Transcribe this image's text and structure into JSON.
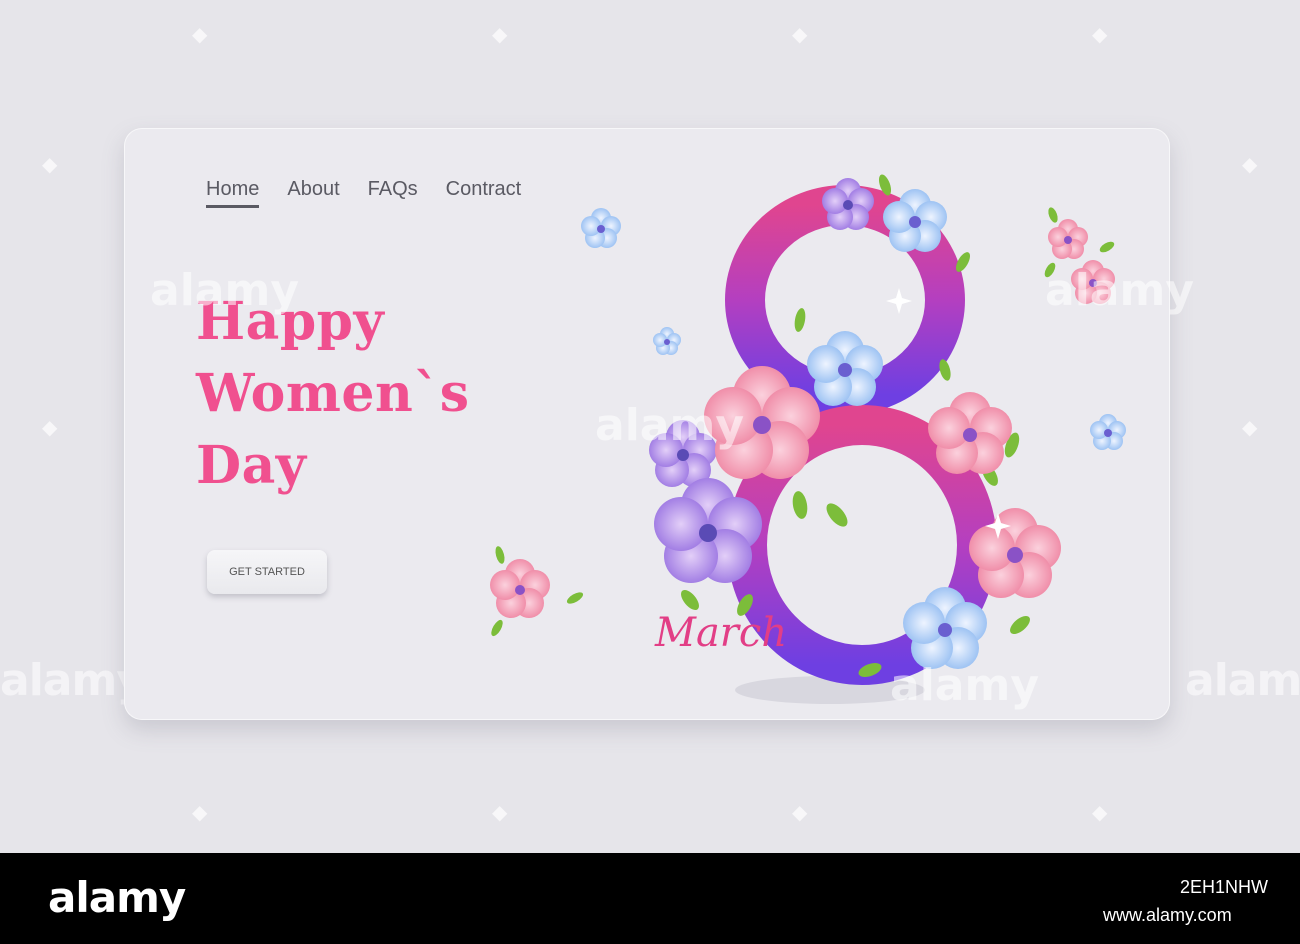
{
  "nav": {
    "items": [
      {
        "label": "Home",
        "active": true
      },
      {
        "label": "About",
        "active": false
      },
      {
        "label": "FAQs",
        "active": false
      },
      {
        "label": "Contract",
        "active": false
      }
    ]
  },
  "hero": {
    "headline_lines": [
      "Happy",
      "Women`s",
      "Day"
    ],
    "cta_label": "GET STARTED"
  },
  "art": {
    "numeral": "8",
    "script_text": "March"
  },
  "watermark": {
    "brand": "alamy"
  },
  "footer": {
    "logo": "alamy",
    "image_id": "2EH1NHW",
    "url": "www.alamy.com"
  },
  "colors": {
    "accent_pink": "#f0508f",
    "numeral_top": "#e0458f",
    "numeral_bottom": "#7b3de0",
    "card": "#ebeaef",
    "background": "#e6e5ea"
  }
}
